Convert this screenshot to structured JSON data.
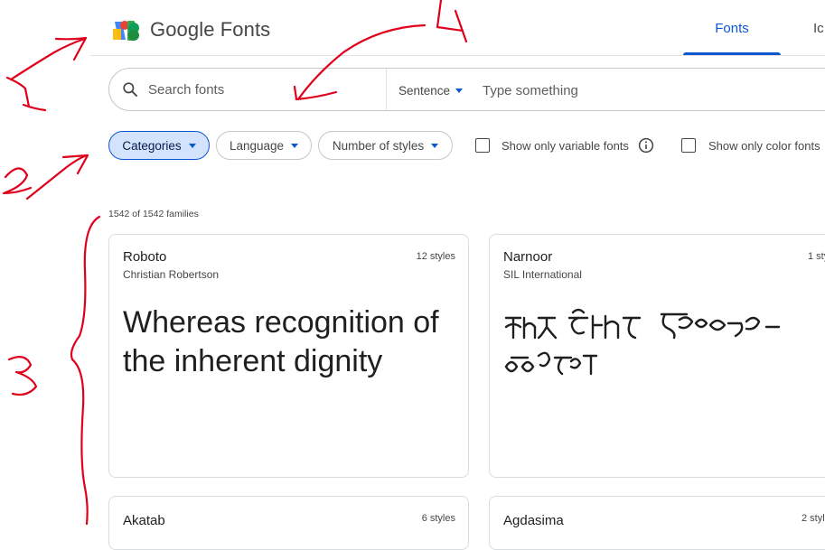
{
  "header": {
    "brand": "Google Fonts",
    "tabs": [
      {
        "label": "Fonts",
        "active": true
      },
      {
        "label": "Ic"
      }
    ]
  },
  "search": {
    "placeholder": "Search fonts",
    "preview_mode": "Sentence",
    "preview_placeholder": "Type something"
  },
  "filters": {
    "chips": [
      "Categories",
      "Language",
      "Number of styles"
    ],
    "checkboxes": [
      {
        "label": "Show only variable fonts",
        "checked": false
      },
      {
        "label": "Show only color fonts",
        "checked": false
      }
    ]
  },
  "results": {
    "count": "1542 of 1542 families",
    "cards": [
      {
        "name": "Roboto",
        "designer": "Christian Robertson",
        "styles": "12 styles",
        "sample": "Whereas recognition of the inherent dignity"
      },
      {
        "name": "Narnoor",
        "designer": "SIL International",
        "styles": "1 sty"
      },
      {
        "name": "Akatab",
        "styles": "6 styles"
      },
      {
        "name": "Agdasima",
        "styles": "2 styl"
      }
    ]
  },
  "annotations": [
    "1",
    "2",
    "3",
    "4"
  ],
  "colors": {
    "accent": "#0b57d0",
    "chip_selected_bg": "#d3e3fd",
    "border": "#c4c7c5",
    "annotation_red": "#e0001b"
  },
  "icons": [
    "google-fonts-logo-icon",
    "search-icon",
    "caret-down-icon",
    "info-icon"
  ]
}
